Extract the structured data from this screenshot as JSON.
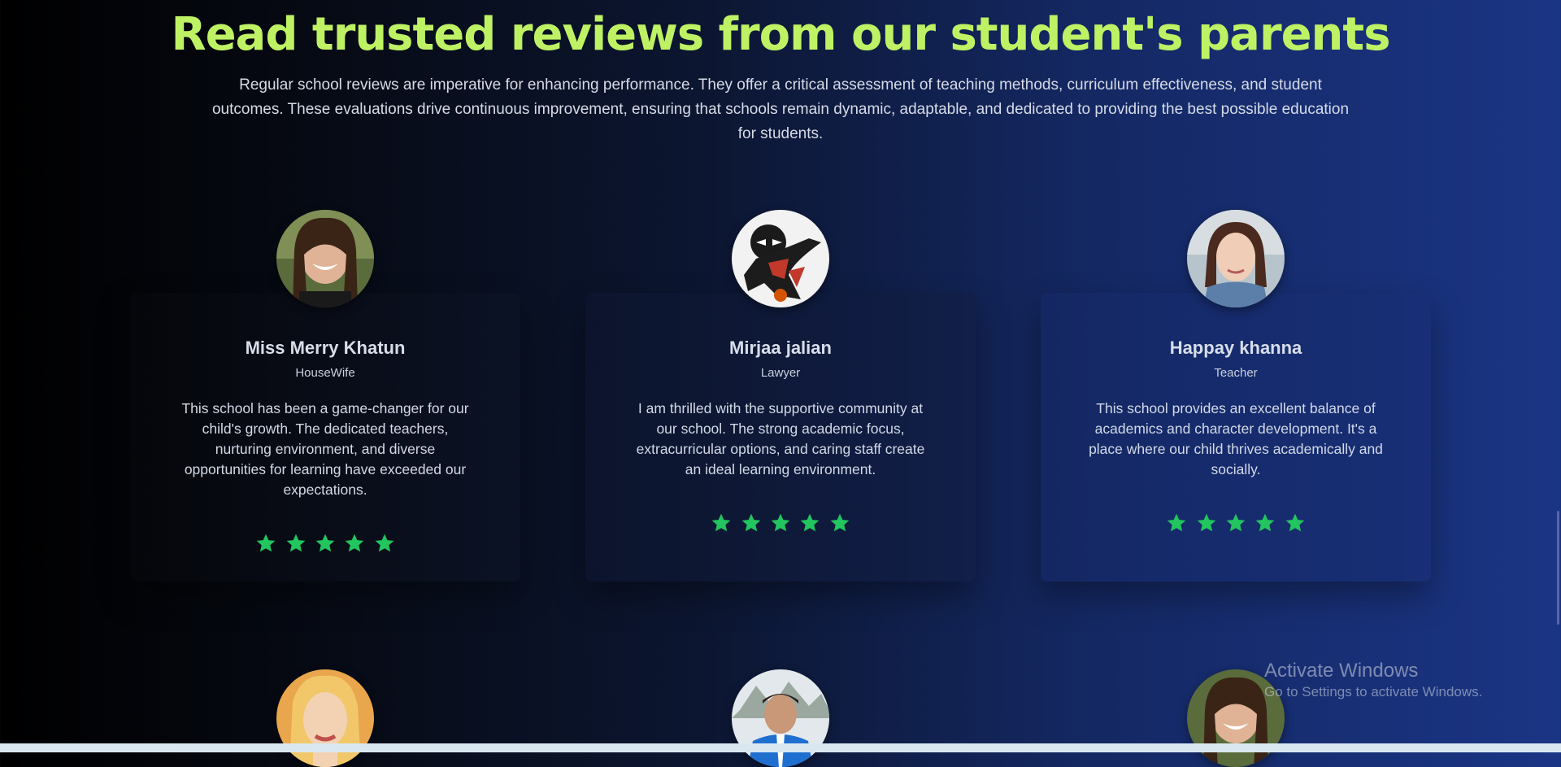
{
  "section": {
    "heading": "Read trusted reviews from our student's parents",
    "intro": "Regular school reviews are imperative for enhancing performance. They offer a critical assessment of teaching methods, curriculum effectiveness, and student outcomes. These evaluations drive continuous improvement, ensuring that schools remain dynamic, adaptable, and dedicated to providing the best possible education for students."
  },
  "reviews": [
    {
      "name": "Miss Merry Khatun",
      "role": "HouseWife",
      "text": "This school has been a game-changer for our child's growth. The dedicated teachers, nurturing environment, and diverse opportunities for learning have exceeded our expectations.",
      "rating": 5
    },
    {
      "name": "Mirjaa jalian",
      "role": "Lawyer",
      "text": "I am thrilled with the supportive community at our school. The strong academic focus, extracurricular options, and caring staff create an ideal learning environment.",
      "rating": 5
    },
    {
      "name": "Happay khanna",
      "role": "Teacher",
      "text": "This school provides an excellent balance of academics and character development. It's a place where our child thrives academically and socially.",
      "rating": 5
    }
  ],
  "colors": {
    "heading": "#bef264",
    "star": "#22c55e"
  },
  "watermark": {
    "title": "Activate Windows",
    "subtitle": "Go to Settings to activate Windows."
  }
}
